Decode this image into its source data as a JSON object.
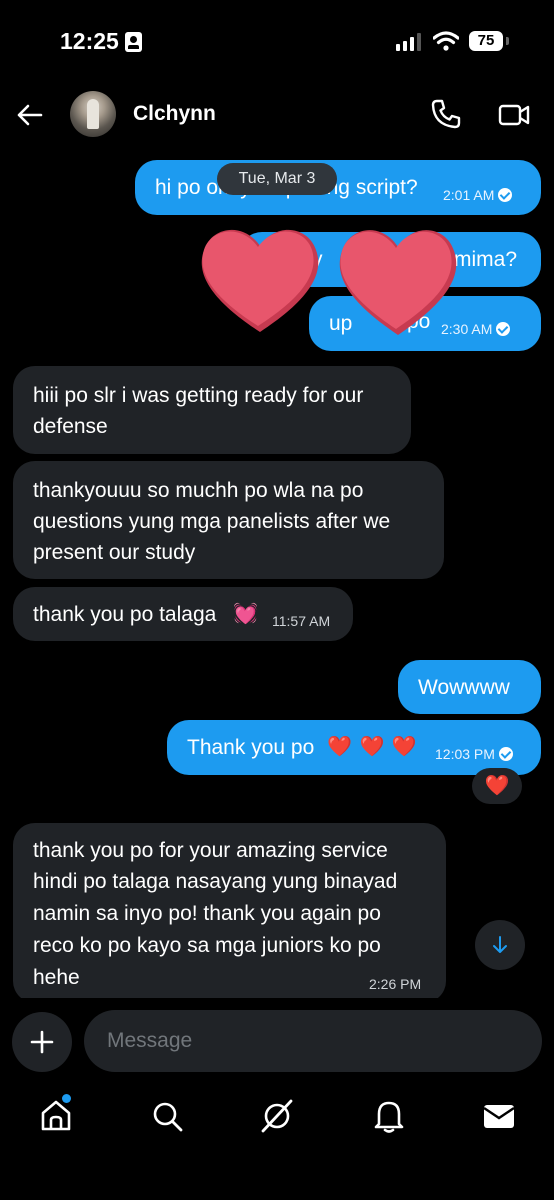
{
  "status": {
    "time": "12:25",
    "battery": "75"
  },
  "header": {
    "name": "Clchynn"
  },
  "chat": {
    "date_pill": "Tue, Mar 3",
    "m1": {
      "text": "hi po okay na po ang script?",
      "time": "2:01 AM"
    },
    "m2": {
      "text": "y",
      "text2": "mima?"
    },
    "m3": {
      "text": "up",
      "text2": "po",
      "time": "2:30 AM"
    },
    "m4": {
      "line1": "hiii po slr i was getting ready for our",
      "line2": "defense"
    },
    "m5": {
      "line1": "thankyouuu so muchh po wla na po",
      "line2": "questions yung mga panelists after we",
      "line3": "present our study"
    },
    "m6": {
      "text": "thank you po talaga",
      "emoji": "💓",
      "time": "11:57 AM"
    },
    "m7": {
      "text": "Wowwww"
    },
    "m8": {
      "text": "Thank you po",
      "hearts": "❤️ ❤️ ❤️",
      "time": "12:03 PM"
    },
    "reaction": "❤️",
    "m9": {
      "line1": "thank you po for your amazing service",
      "line2": "hindi po talaga nasayang yung binayad",
      "line3": "namin sa inyo po! thank you again po",
      "line4": "reco ko po kayo sa mga juniors ko po",
      "line5": "hehe",
      "time": "2:26 PM"
    }
  },
  "composer": {
    "placeholder": "Message"
  },
  "icons": {
    "back": "arrow-left-icon",
    "call": "phone-icon",
    "video": "video-camera-icon",
    "plus": "plus-icon",
    "scroll": "arrow-down-icon",
    "tabs": [
      "home-icon",
      "search-icon",
      "grok-icon",
      "bell-icon",
      "mail-icon"
    ]
  },
  "colors": {
    "accent": "#1d9bf0",
    "bubble_in": "#202327",
    "background": "#000000",
    "sticker_heart": "#e8566c"
  }
}
